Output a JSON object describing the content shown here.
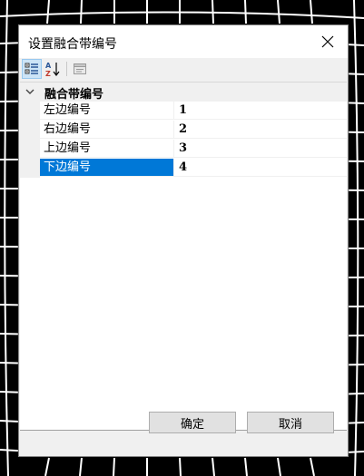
{
  "dialog": {
    "title": "设置融合带编号",
    "ok_label": "确定",
    "cancel_label": "取消"
  },
  "toolbar": {
    "buttons": [
      {
        "name": "categorized",
        "active": true
      },
      {
        "name": "alphabetical",
        "active": false
      },
      {
        "name": "property-pages",
        "active": false
      }
    ]
  },
  "property_grid": {
    "category": "融合带编号",
    "properties": [
      {
        "name": "左边编号",
        "value": "1"
      },
      {
        "name": "右边编号",
        "value": "2"
      },
      {
        "name": "上边编号",
        "value": "3"
      },
      {
        "name": "下边编号",
        "value": "4",
        "selected": true
      }
    ]
  },
  "colors": {
    "selection": "#0078d7",
    "dialog_bg": "#f0f0f0",
    "background": "#000000",
    "grid_lines": "#ffffff"
  }
}
